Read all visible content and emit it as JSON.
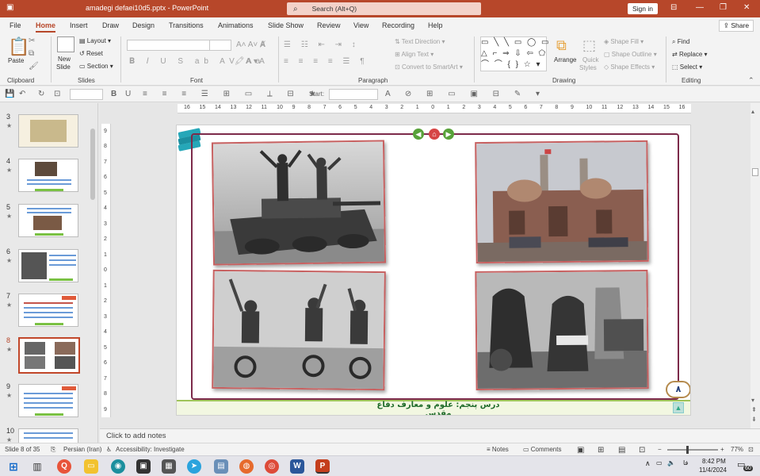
{
  "titlebar": {
    "doc_title": "amadegi defaei10d5.pptx  -  PowerPoint",
    "search_placeholder": "Search (Alt+Q)",
    "sign_in": "Sign in",
    "search_icon": "search-icon",
    "accent": "#b7472a"
  },
  "tabs": [
    "File",
    "Home",
    "Insert",
    "Draw",
    "Design",
    "Transitions",
    "Animations",
    "Slide Show",
    "Review",
    "View",
    "Recording",
    "Help"
  ],
  "active_tab": "Home",
  "share_label": "Share",
  "ribbon": {
    "clipboard": {
      "label": "Clipboard",
      "paste": "Paste"
    },
    "slides": {
      "label": "Slides",
      "new_slide": "New",
      "new_slide2": "Slide",
      "layout": "Layout",
      "reset": "Reset",
      "section": "Section"
    },
    "font": {
      "label": "Font"
    },
    "paragraph": {
      "label": "Paragraph",
      "text_direction": "Text Direction",
      "align_text": "Align Text",
      "convert_smartart": "Convert to SmartArt"
    },
    "drawing": {
      "label": "Drawing",
      "arrange": "Arrange",
      "quick_styles": "Quick",
      "quick_styles2": "Styles",
      "shape_fill": "Shape Fill",
      "shape_outline": "Shape Outline",
      "shape_effects": "Shape Effects"
    },
    "editing": {
      "label": "Editing",
      "find": "Find",
      "replace": "Replace",
      "select": "Select"
    }
  },
  "qat": {
    "start_label": "Start:"
  },
  "thumbnails": [
    {
      "num": "3"
    },
    {
      "num": "4"
    },
    {
      "num": "5"
    },
    {
      "num": "6"
    },
    {
      "num": "7"
    },
    {
      "num": "8"
    },
    {
      "num": "9"
    },
    {
      "num": "10"
    }
  ],
  "selected_slide": "8",
  "ruler": {
    "h_ticks": [
      "16",
      "15",
      "14",
      "13",
      "12",
      "11",
      "10",
      "9",
      "8",
      "7",
      "6",
      "5",
      "4",
      "3",
      "2",
      "1",
      "0",
      "1",
      "2",
      "3",
      "4",
      "5",
      "6",
      "7",
      "8",
      "9",
      "10",
      "11",
      "12",
      "13",
      "14",
      "15",
      "16"
    ],
    "v_ticks": [
      "9",
      "8",
      "7",
      "6",
      "5",
      "4",
      "3",
      "2",
      "1",
      "0",
      "1",
      "2",
      "3",
      "4",
      "5",
      "6",
      "7",
      "8",
      "9"
    ]
  },
  "slide": {
    "lesson_title": "درس پنجم: علوم و معارف دفاع مقدس",
    "page_number": "۸"
  },
  "notes_placeholder": "Click to add notes",
  "status": {
    "slide_info": "Slide 8 of 35",
    "language": "Persian (Iran)",
    "accessibility": "Accessibility: Investigate",
    "notes": "Notes",
    "comments": "Comments",
    "zoom": "77%"
  },
  "taskbar": {
    "time": "8:42 PM",
    "date": "11/4/2024",
    "lang": "فا",
    "notif": "60"
  }
}
